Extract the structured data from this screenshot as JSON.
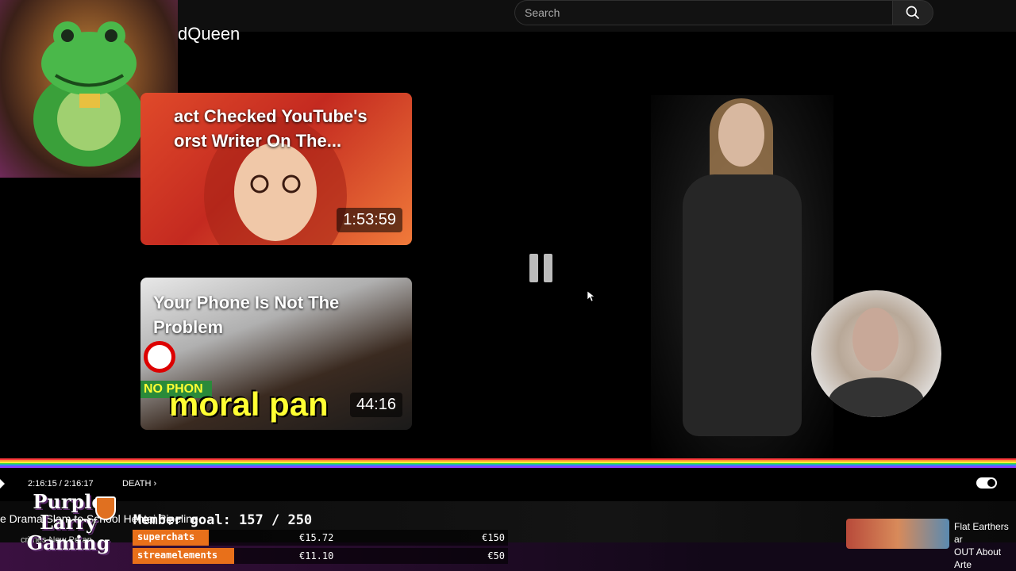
{
  "search": {
    "placeholder": "Search"
  },
  "channel": {
    "title_fragment": "dQueen"
  },
  "videos": [
    {
      "title": "act Checked YouTube's\norst Writer On The...",
      "duration": "1:53:59"
    },
    {
      "title": "Your Phone Is Not The Problem",
      "duration": "44:16",
      "overlay_text": "moral pan",
      "badge": "NO PHON"
    }
  ],
  "player": {
    "time": "2:16:15 / 2:16:17",
    "chapter": "DEATH",
    "state_icon": "pause-icon"
  },
  "overlay": {
    "logo_text": "Purple\nLarry\nGaming",
    "marquee_text": "e Drama Slam to School Hentai Pipeline",
    "marquee_sub": "crimes Now Poran",
    "goal_label": "Member goal: 157 / 250",
    "donations": [
      {
        "source": "superchats",
        "amount": "€15.72",
        "target": "€150"
      },
      {
        "source": "streamelements",
        "amount": "€11.10",
        "target": "€50"
      }
    ]
  },
  "recommended": {
    "title": "Flat Earthers ar\nOUT About Arte"
  },
  "colors": {
    "accent": "#e8701a",
    "progress": "rainbow",
    "logo_shadow": "#5a2a6a"
  }
}
